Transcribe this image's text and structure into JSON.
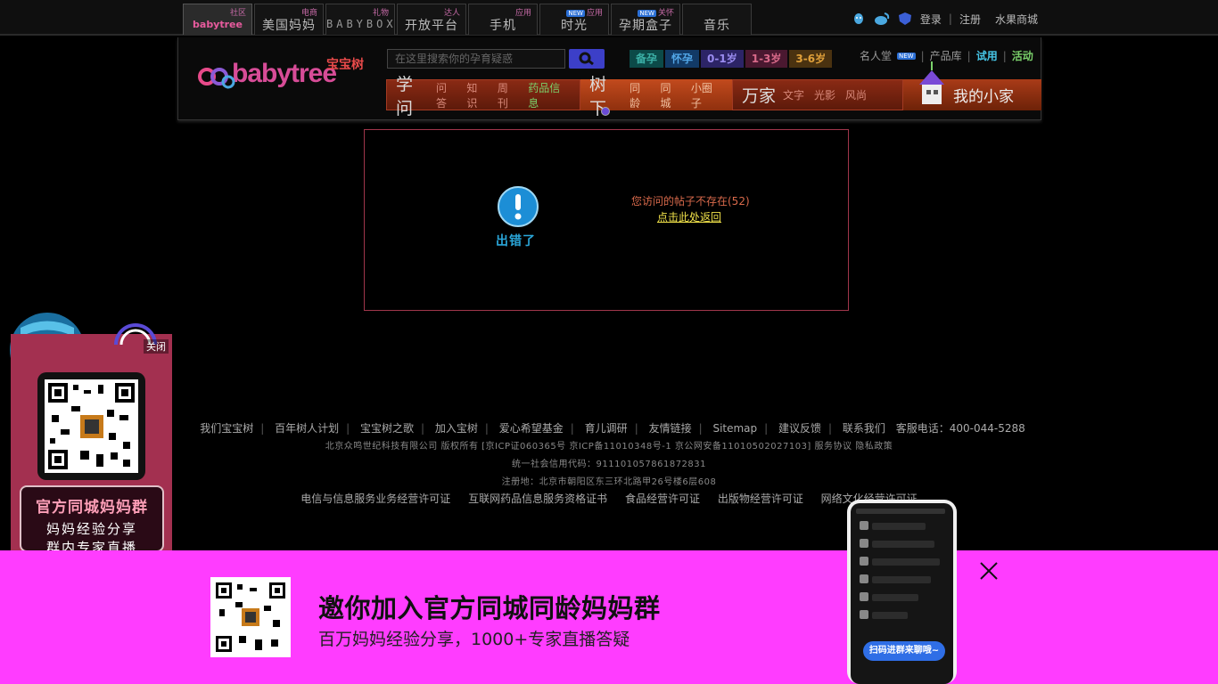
{
  "topbar": {
    "tabs": [
      {
        "main": "babytree",
        "tag": "社区"
      },
      {
        "main": "美国妈妈",
        "tag": "电商"
      },
      {
        "main": "BABYBOX",
        "tag": "礼物"
      },
      {
        "main": "开放平台",
        "tag": "达人"
      },
      {
        "main": "手机",
        "tag": "应用"
      },
      {
        "main": "时光",
        "tag": "应用",
        "new": "NEW"
      },
      {
        "main": "孕期盒子",
        "tag": "关怀",
        "new": "NEW"
      },
      {
        "main": "音乐",
        "tag": ""
      }
    ],
    "login": "登录",
    "register": "注册",
    "mall": "水果商城"
  },
  "header": {
    "logo_en": "babytree",
    "logo_cn": "宝宝树",
    "search_placeholder": "在这里搜索你的孕育疑惑",
    "stages": [
      {
        "label": "备孕",
        "color": "#3bb0a6",
        "bg": "#0c4a48"
      },
      {
        "label": "怀孕",
        "color": "#52a7e8",
        "bg": "#123a66"
      },
      {
        "label": "0-1岁",
        "color": "#9a8cf0",
        "bg": "#2c2466"
      },
      {
        "label": "1-3岁",
        "color": "#d96a8a",
        "bg": "#4a1830"
      },
      {
        "label": "3-6岁",
        "color": "#e0a03a",
        "bg": "#4a3210"
      }
    ],
    "right_links": {
      "celebrity": "名人堂",
      "new": "NEW",
      "products": "产品库",
      "trial": "试用",
      "activity": "活动"
    },
    "nav": {
      "xuewen": {
        "big": "学问",
        "subs": [
          "问答",
          "知识",
          "周刊",
          "药品信息"
        ]
      },
      "shuxia": {
        "big": "树下",
        "subs": [
          "同龄",
          "同城",
          "小圈子"
        ]
      },
      "wanjia": {
        "big": "万家",
        "subs": [
          "文字",
          "光影",
          "风尚"
        ]
      },
      "myhome": "我的小家"
    }
  },
  "error": {
    "label": "出错了",
    "message": "您访问的帖子不存在(52)",
    "back": "点击此处返回"
  },
  "footer": {
    "links": [
      "我们宝宝树",
      "百年树人计划",
      "宝宝树之歌",
      "加入宝树",
      "爱心希望基金",
      "育儿调研",
      "友情链接",
      "Sitemap",
      "建议反馈",
      "联系我们"
    ],
    "hotline": "客服电话：400-044-5288",
    "copyright": "北京众鸣世纪科技有限公司 版权所有 [京ICP证060365号 京ICP备11010348号-1 京公网安备11010502027103] 服务协议 隐私政策",
    "credit_code": "统一社会信用代码：911101057861872831",
    "address": "注册地：北京市朝阳区东三环北路甲26号楼6层608",
    "licenses": [
      "电信与信息服务业务经营许可证",
      "互联网药品信息服务资格证书",
      "食品经营许可证",
      "出版物经营许可证",
      "网络文化经营许可证"
    ]
  },
  "left_ad": {
    "close": "关闭",
    "title": "官方同城妈妈群",
    "line1": "妈妈经验分享",
    "line2": "群内专家直播"
  },
  "banner": {
    "title": "邀你加入官方同城同龄妈妈群",
    "subtitle": "百万妈妈经验分享，1000+专家直播答疑",
    "phone_button": "扫码进群来聊哦~"
  }
}
